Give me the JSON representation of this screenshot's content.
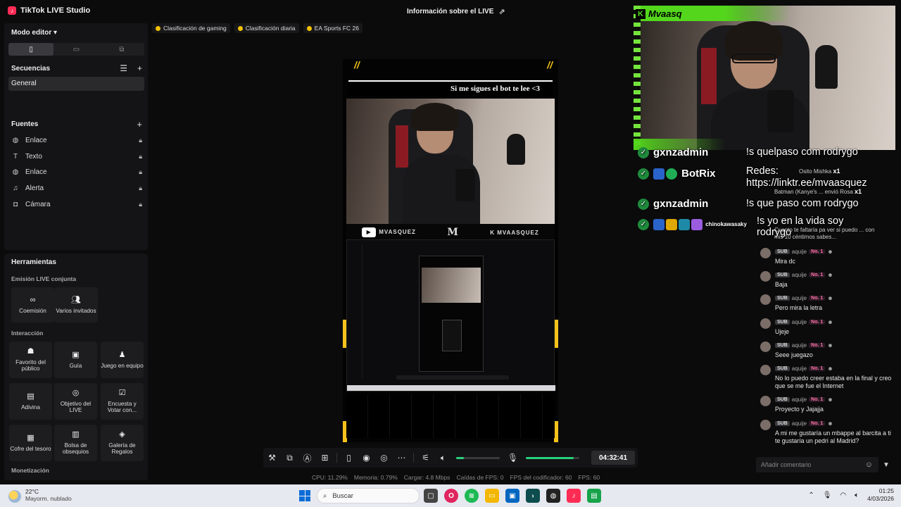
{
  "titlebar": {
    "app_title": "TikTok LIVE Studio",
    "live_info": "Información sobre el LIVE"
  },
  "left": {
    "mode_editor": "Modo editor",
    "sequences_title": "Secuencias",
    "sequence_item": "General",
    "sources_title": "Fuentes",
    "sources": [
      {
        "label": "Enlace",
        "icon": "globe-icon"
      },
      {
        "label": "Texto",
        "icon": "text-icon"
      },
      {
        "label": "Enlace",
        "icon": "globe-icon"
      },
      {
        "label": "Alerta",
        "icon": "bell-icon"
      },
      {
        "label": "Cámara",
        "icon": "camera-icon"
      }
    ],
    "tools_title": "Herramientas",
    "cat_cohost": "Emisión LIVE conjunta",
    "cat_interaction": "Interacción",
    "cat_monetization": "Monetización",
    "tiles": {
      "cohost": "Coemisión",
      "guests": "Varios invitados",
      "favorite": "Favorito del público",
      "guide": "Guía",
      "team_game": "Juego en equipo",
      "guess": "Adivina",
      "goal": "Objetivo del LIVE",
      "poll": "Encuesta y Votar con...",
      "chest": "Cofre del tesoro",
      "goodie_bag": "Bolsa de obsequios",
      "gift_gallery": "Galería de Regalos"
    }
  },
  "chips": [
    "Clasificación de gaming",
    "Clasificación diaria",
    "EA Sports FC 26"
  ],
  "canvas": {
    "banner": "Si me sigues el bot te lee <3",
    "social_1": "MVASQUEZ",
    "social_2": "MVAASQUEZ",
    "logo": "M"
  },
  "control_bar": {
    "timer": "04:32:41",
    "volume_level": 0.18,
    "mic_level": 0.9
  },
  "stats": {
    "cpu": "CPU: 11.29%",
    "memory": "Memoria: 0.79%",
    "load": "Cargar: 4.8 Mbps",
    "fps_drops": "Caídas de FPS: 0",
    "encoder_fps": "FPS del codificador: 60",
    "fps": "FPS: 60"
  },
  "webcam": {
    "name": "Mvaasq"
  },
  "overlay_chat": [
    {
      "user": "gxnzadmin",
      "msg": "!s quelpaso com rodrygo"
    },
    {
      "user": "BotRix",
      "msg": "Redes: https://linktr.ee/mvaasquez"
    },
    {
      "user": "gxnzadmin",
      "msg": "!s que paso com rodrygo"
    },
    {
      "user": "chinokawasaky",
      "msg": "!s yo en la vida soy rodrygo"
    }
  ],
  "gifts": [
    {
      "text": "Osito Mishka",
      "count": "x1"
    },
    {
      "text": "Batman (Kanye's ... envió Rosa",
      "count": "x1"
    }
  ],
  "question": "Cuanto te faltaría pa ver si puedo ... con mis 10 céntimos sabes...",
  "chat": {
    "sub_label": "SUB",
    "rank_label": "No. 1",
    "messages": [
      {
        "user": "aquije",
        "text": "Mira dc"
      },
      {
        "user": "aquije",
        "text": "Baja"
      },
      {
        "user": "aquije",
        "text": "Pero mira la letra"
      },
      {
        "user": "aquije",
        "text": "Ujeje"
      },
      {
        "user": "aquije",
        "text": "Seee juegazo"
      },
      {
        "user": "aquije",
        "text": "No lo puedo creer estaba en la final y creo que se me fue el Internet"
      },
      {
        "user": "aquije",
        "text": "Proyecto y Jajajja"
      },
      {
        "user": "aquije",
        "text": "A mi me gustaría un mbappe al barcita a ti te gustaría un pedri al Madrid?"
      }
    ],
    "comment_placeholder": "Añadir comentario"
  },
  "taskbar": {
    "temp": "22°C",
    "weather": "Mayorm. nublado",
    "search": "Buscar",
    "time": "01:25",
    "date": "4/03/2026"
  },
  "colors": {
    "accent_green": "#28d17c",
    "overlay_green": "#53d61b",
    "tiktok_pink": "#fe2c55",
    "chip_gold": "#f2c200"
  }
}
